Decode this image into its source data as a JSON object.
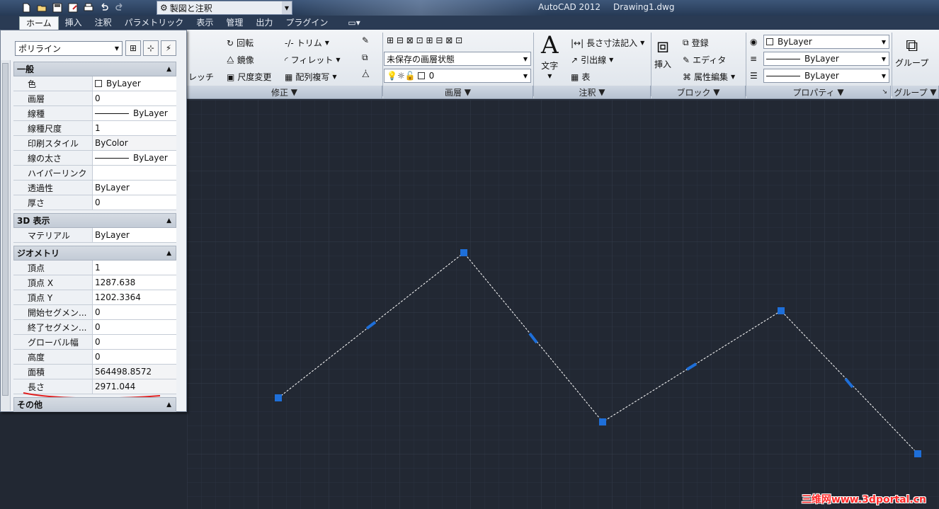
{
  "window": {
    "app_title": "AutoCAD 2012",
    "doc_title": "Drawing1.dwg"
  },
  "workspace": {
    "label": "製図と注釈"
  },
  "tabs": [
    "ホーム",
    "挿入",
    "注釈",
    "パラメトリック",
    "表示",
    "管理",
    "出力",
    "プラグイン"
  ],
  "ribbon": {
    "modify": {
      "title": "修正",
      "rotate": "回転",
      "mirror": "鏡像",
      "stretch": "レッチ",
      "scale": "尺度変更",
      "trim": "トリム",
      "fillet": "フィレット",
      "array": "配列複写"
    },
    "layers": {
      "title": "画層",
      "state": "未保存の画層状態",
      "layer": "0"
    },
    "annotation": {
      "title": "注釈",
      "text": "文字",
      "dim": "長さ寸法記入",
      "leader": "引出線",
      "table": "表"
    },
    "block": {
      "title": "ブロック",
      "insert": "挿入",
      "create": "登録",
      "edit": "エディタ",
      "attr": "属性編集"
    },
    "properties": {
      "title": "プロパティ",
      "color": "ByLayer",
      "linetype": "ByLayer",
      "lineweight": "ByLayer"
    },
    "groups": {
      "title": "グループ",
      "group": "グループ"
    }
  },
  "props": {
    "type": "ポリライン",
    "general": {
      "title": "一般",
      "rows": [
        {
          "k": "色",
          "v": "ByLayer"
        },
        {
          "k": "画層",
          "v": "0"
        },
        {
          "k": "線種",
          "v": "ByLayer"
        },
        {
          "k": "線種尺度",
          "v": "1"
        },
        {
          "k": "印刷スタイル",
          "v": "ByColor"
        },
        {
          "k": "線の太さ",
          "v": "ByLayer"
        },
        {
          "k": "ハイパーリンク",
          "v": ""
        },
        {
          "k": "透過性",
          "v": "ByLayer"
        },
        {
          "k": "厚さ",
          "v": "0"
        }
      ]
    },
    "display3d": {
      "title": "3D 表示",
      "rows": [
        {
          "k": "マテリアル",
          "v": "ByLayer"
        }
      ]
    },
    "geometry": {
      "title": "ジオメトリ",
      "rows": [
        {
          "k": "頂点",
          "v": "1"
        },
        {
          "k": "頂点 X",
          "v": "1287.638"
        },
        {
          "k": "頂点 Y",
          "v": "1202.3364"
        },
        {
          "k": "開始セグメン...",
          "v": "0"
        },
        {
          "k": "終了セグメン...",
          "v": "0"
        },
        {
          "k": "グローバル幅",
          "v": "0"
        },
        {
          "k": "高度",
          "v": "0"
        },
        {
          "k": "面積",
          "v": "564498.8572"
        },
        {
          "k": "長さ",
          "v": "2971.044"
        }
      ]
    },
    "other": {
      "title": "その他"
    }
  },
  "watermark": "三维网www.3dportal.cn",
  "colors": {
    "canvas": "#222833",
    "grip": "#1e6fd9",
    "annotation_underline": "#e02020"
  }
}
